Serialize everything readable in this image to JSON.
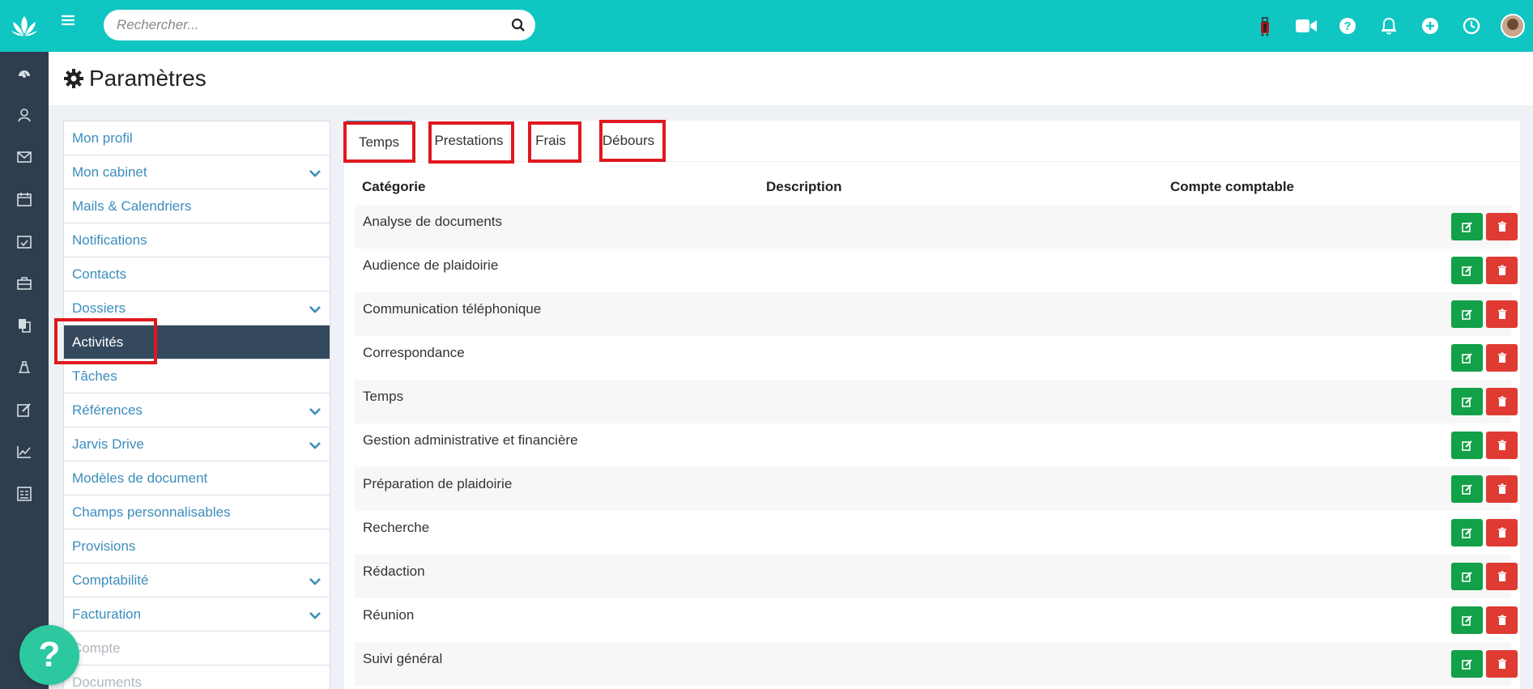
{
  "header": {
    "search_placeholder": "Rechercher...",
    "icons": [
      "suitcase-icon",
      "video-icon",
      "help-icon",
      "bell-icon",
      "plus-icon",
      "clock-icon",
      "avatar"
    ]
  },
  "page": {
    "title": "Paramètres"
  },
  "sidebar_nav": [
    "dashboard-icon",
    "contacts-icon",
    "mail-icon",
    "calendar-icon",
    "tasks-icon",
    "briefcase-icon",
    "documents-icon",
    "billing-icon",
    "edit-icon",
    "chart-icon",
    "report-icon"
  ],
  "settings_menu": {
    "items": [
      {
        "label": "Mon profil",
        "chevron": false
      },
      {
        "label": "Mon cabinet",
        "chevron": true
      },
      {
        "label": "Mails & Calendriers",
        "chevron": false
      },
      {
        "label": "Notifications",
        "chevron": false
      },
      {
        "label": "Contacts",
        "chevron": false
      },
      {
        "label": "Dossiers",
        "chevron": true
      },
      {
        "label": "Activités",
        "chevron": false,
        "active": true
      },
      {
        "label": "Tâches",
        "chevron": false
      },
      {
        "label": "Références",
        "chevron": true
      },
      {
        "label": "Jarvis Drive",
        "chevron": true
      },
      {
        "label": "Modèles de document",
        "chevron": false
      },
      {
        "label": "Champs personnalisables",
        "chevron": false
      },
      {
        "label": "Provisions",
        "chevron": false
      },
      {
        "label": "Comptabilité",
        "chevron": true
      },
      {
        "label": "Facturation",
        "chevron": true
      },
      {
        "label": "Compte",
        "chevron": false
      },
      {
        "label": "Documents",
        "chevron": false
      }
    ]
  },
  "tabs": [
    {
      "label": "Temps",
      "active": true
    },
    {
      "label": "Prestations",
      "active": false
    },
    {
      "label": "Frais",
      "active": false
    },
    {
      "label": "Débours",
      "active": false
    }
  ],
  "table": {
    "headers": [
      "Catégorie",
      "Description",
      "Compte comptable"
    ],
    "rows": [
      "Analyse de documents",
      "Audience de plaidoirie",
      "Communication téléphonique",
      "Correspondance",
      "Temps",
      "Gestion administrative et financière",
      "Préparation de plaidoirie",
      "Recherche",
      "Rédaction",
      "Réunion",
      "Suivi général"
    ]
  },
  "help_button": {
    "label": "?"
  },
  "colors": {
    "brand": "#0fc6c2",
    "rail": "#2f3e4e",
    "link": "#3c8dbc",
    "active_item": "#34495e",
    "edit": "#12a048",
    "delete": "#df3b32",
    "highlight": "#e0181f"
  }
}
